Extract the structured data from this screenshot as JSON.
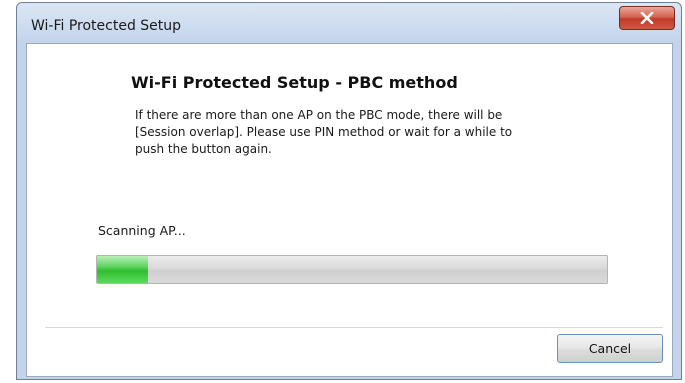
{
  "window": {
    "title": "Wi-Fi Protected Setup"
  },
  "titlebar": {
    "close_icon": "close-icon"
  },
  "content": {
    "heading": "Wi-Fi Protected Setup - PBC method",
    "description": "If there are more than one AP on the PBC mode, there will be\n[Session overlap]. Please use PIN method or wait for a while to\npush the button again.",
    "status_text": "Scanning AP..."
  },
  "progress": {
    "value": 0.1,
    "color": "#3cc83c"
  },
  "footer": {
    "cancel_label": "Cancel"
  }
}
